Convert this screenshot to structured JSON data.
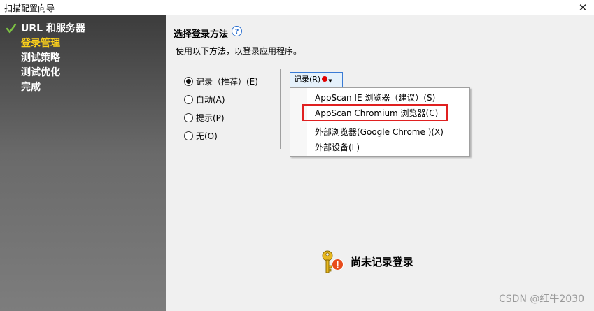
{
  "window": {
    "title": "扫描配置向导",
    "close_glyph": "✕"
  },
  "sidebar": {
    "steps": [
      {
        "label": "URL 和服务器",
        "state": "done"
      },
      {
        "label": "登录管理",
        "state": "active"
      },
      {
        "label": "测试策略",
        "state": "pending"
      },
      {
        "label": "测试优化",
        "state": "pending"
      },
      {
        "label": "完成",
        "state": "pending"
      }
    ]
  },
  "main": {
    "section_title": "选择登录方法",
    "help_glyph": "?",
    "description": "使用以下方法，以登录应用程序。",
    "radios": [
      {
        "label": "记录（推荐）(E)",
        "checked": true
      },
      {
        "label": "自动(A)",
        "checked": false
      },
      {
        "label": "提示(P)",
        "checked": false
      },
      {
        "label": "无(O)",
        "checked": false
      }
    ],
    "record_button": {
      "label": "记录(R)"
    },
    "dropdown": {
      "items": [
        {
          "label": "AppScan IE 浏览器（建议）(S)"
        },
        {
          "label": "AppScan Chromium 浏览器(C)",
          "highlighted": true
        },
        {
          "label": "外部浏览器(Google Chrome )(X)"
        },
        {
          "label": "外部设备(L)"
        }
      ]
    },
    "status": {
      "text": "尚未记录登录"
    }
  },
  "watermark": "CSDN @红牛2030",
  "colors": {
    "active_step": "#ffd21a",
    "check": "#7cc242",
    "record_dot": "#e00000",
    "highlight_box": "#e02020",
    "warning": "#e84c1c"
  }
}
